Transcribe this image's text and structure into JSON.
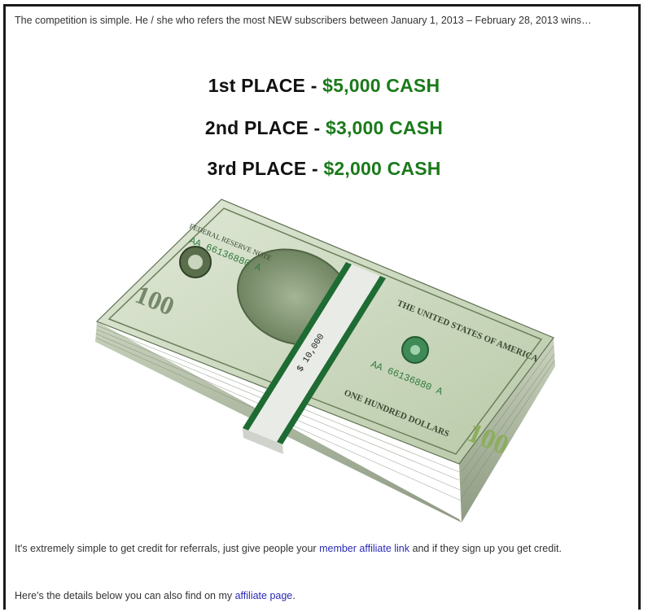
{
  "intro": "The competition is simple. He / she who refers the most NEW subscribers between January 1, 2013 – February 28, 2013 wins…",
  "prizes": [
    {
      "place": "1st PLACE - ",
      "amount": "$5,000 CASH"
    },
    {
      "place": "2nd PLACE - ",
      "amount": "$3,000 CASH"
    },
    {
      "place": "3rd PLACE - ",
      "amount": "$2,000 CASH"
    }
  ],
  "image": {
    "band_text": "$ 10,000",
    "serial": "AA 66136880 A",
    "note_text": "FEDERAL RESERVE NOTE",
    "country_text": "THE UNITED STATES OF AMERICA",
    "denom_text": "ONE HUNDRED DOLLARS",
    "denomination": "100"
  },
  "credit": {
    "before": "It's extremely simple to get credit for referrals, just give people your ",
    "link": "member affiliate link",
    "after": " and if they sign up you get credit."
  },
  "details": {
    "before": "Here's the details below you can also find on my ",
    "link": "affiliate page",
    "after": "."
  },
  "colors": {
    "cash": "#1a7a1a",
    "link": "#2a2ab8",
    "band_stripe": "#1e6b33"
  }
}
